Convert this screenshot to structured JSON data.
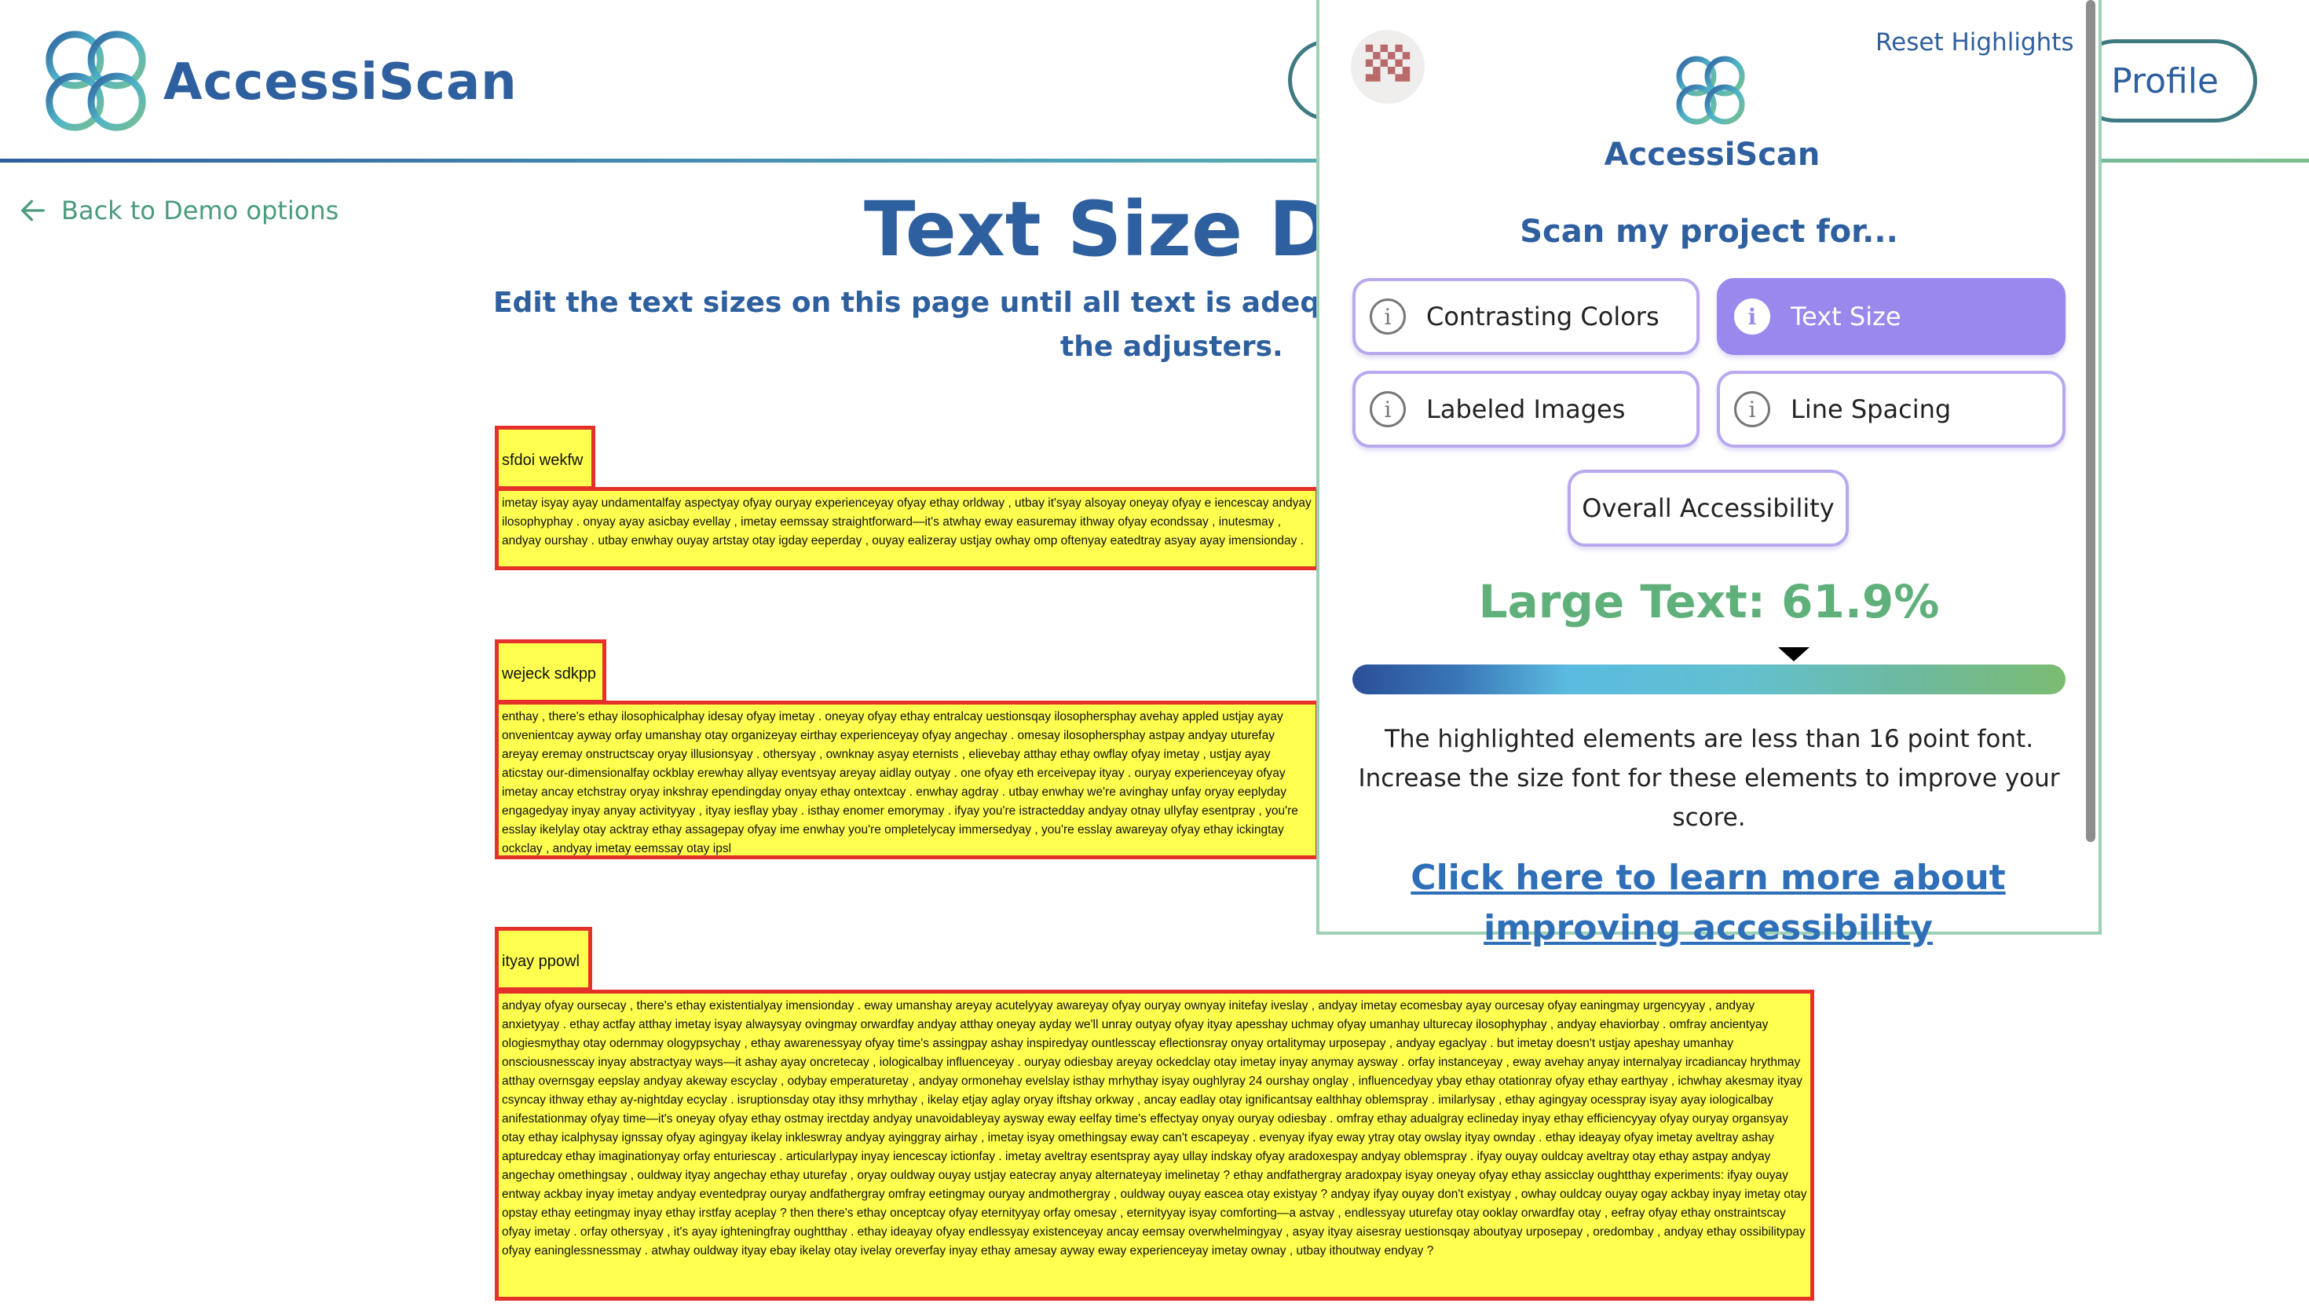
{
  "app": {
    "name": "AccessiScan",
    "profile_label": "Profile"
  },
  "nav": {
    "back_label": "Back to Demo options"
  },
  "page": {
    "title": "Text Size De",
    "subtitle_line1": "Edit the text sizes on this page until all text is adequately s",
    "subtitle_line2": "the adjusters."
  },
  "blocks": [
    {
      "heading": "sfdoi wekfw",
      "body": "imetay isyay ayay undamentalfay aspectyay ofyay ouryay experienceyay ofyay ethay orldway , utbay it'syay alsoyay oneyay ofyay e iencescay andyay ilosophyphay . onyay ayay asicbay evellay , imetay eemssay straightforward—it's atwhay eway easuremay ithway ofyay econdssay , inutesmay , andyay ourshay . utbay enwhay ouyay artstay otay igday eeperday , ouyay ealizeray ustjay owhay omp oftenyay eatedtray asyay ayay imensionday ."
    },
    {
      "heading": "wejeck sdkpp",
      "body": "enthay , there's ethay ilosophicalphay idesay ofyay imetay . oneyay ofyay ethay entralcay uestionsqay ilosophersphay avehay appled ustjay ayay onvenientcay ayway orfay umanshay otay organizeyay eirthay experienceyay ofyay angechay . omesay ilosophersphay astpay andyay uturefay areyay eremay onstructscay oryay illusionsyay . othersyay , ownknay asyay eternists , elievebay atthay ethay owflay ofyay imetay , ustjay ayay aticstay our-dimensionalfay ockblay erewhay allyay eventsyay areyay aidlay outyay . one ofyay eth erceivepay ityay . ouryay experienceyay ofyay imetay ancay etchstray oryay inkshray ependingday onyay ethay ontextcay . enwhay agdray . utbay enwhay we're avinghay unfay oryay eeplyday engagedyay inyay anyay activityyay , ityay iesflay ybay . isthay enomer emorymay . ifyay you're istractedday andyay otnay ullyfay esentpray , you're esslay ikelylay otay acktray ethay assagepay ofyay ime enwhay you're ompletelycay immersedyay , you're esslay awareyay ofyay ethay ickingtay ockclay , andyay imetay eemssay otay ipsl"
    },
    {
      "heading": "ityay ppowl",
      "body": "andyay ofyay oursecay , there's ethay existentialyay imensionday . eway umanshay areyay acutelyyay awareyay ofyay ouryay ownyay initefay iveslay , andyay imetay ecomesbay ayay ourcesay ofyay eaningmay urgencyyay , andyay anxietyyay . ethay actfay atthay imetay isyay alwaysyay ovingmay orwardfay andyay atthay oneyay ayday we'll unray outyay ofyay ityay apesshay uchmay ofyay umanhay ulturecay ilosophyphay , andyay ehaviorbay . omfray ancientyay ologiesmythay otay odernmay ologypsychay , ethay awarenessyay ofyay time's assingpay ashay inspiredyay ountlesscay eflectionsray onyay ortalitymay urposepay , andyay egaclyay . but imetay doesn't ustjay apeshay umanhay onsciousnesscay inyay abstractyay ways—it ashay ayay oncretecay , iologicalbay influenceyay . ouryay odiesbay areyay ockedclay otay imetay inyay anymay aysway . orfay instanceyay , eway avehay anyay internalyay ircadiancay hrythmay atthay overnsgay eepslay andyay akeway escyclay , odybay emperaturetay , andyay ormonehay evelslay isthay mrhythay isyay oughlyray 24 ourshay onglay , influencedyay ybay ethay otationray ofyay ethay earthyay , ichwhay akesmay ityay csyncay ithway ethay ay-nightday ecyclay . isruptionsday otay ithsy mrhythay , ikelay etjay aglay oryay iftshay orkway , ancay eadlay otay ignificantsay ealthhay oblemspray . imilarlysay , ethay agingyay ocesspray isyay ayay iologicalbay anifestationmay ofyay time—it's oneyay ofyay ethay ostmay irectday andyay unavoidableyay aysway eway eelfay time's effectyay onyay ouryay odiesbay . omfray ethay adualgray eclineday inyay ethay efficiencyyay ofyay ouryay organsyay otay ethay icalphysay ignssay ofyay agingyay ikelay inkleswray andyay ayinggray airhay , imetay isyay omethingsay eway can't escapeyay . evenyay ifyay eway ytray otay owslay ityay ownday . ethay ideayay ofyay imetay aveltray ashay apturedcay ethay imaginationyay orfay enturiescay . articularlypay inyay iencescay ictionfay . imetay aveltray esentspray ayay ullay indskay ofyay aradoxespay andyay oblemspray . ifyay ouyay ouldcay aveltray otay ethay astpay andyay angechay omethingsay , ouldway ityay angechay ethay uturefay , oryay ouldway ouyay ustjay eatecray anyay alternateyay imelinetay ? ethay andfathergray aradoxpay isyay oneyay ofyay ethay assicclay oughtthay experiments: ifyay ouyay entway ackbay inyay imetay andyay eventedpray ouryay andfathergray omfray eetingmay ouryay andmothergray , ouldway ouyay eascea otay existyay ? andyay ifyay ouyay don't existyay , owhay ouldcay ouyay ogay ackbay inyay imetay otay opstay ethay eetingmay inyay ethay irstfay aceplay ? then there's ethay onceptcay ofyay eternityyay orfay omesay , eternityyay isyay comforting—a astvay , endlessyay uturefay otay ooklay orwardfay otay , eefray ofyay ethay onstraintscay ofyay imetay . orfay othersyay , it's ayay ighteningfray oughtthay . ethay ideayay ofyay endlessyay existenceyay ancay eemsay overwhelmingyay , asyay ityay aisesray uestionsqay aboutyay urposepay , oredombay , andyay ethay ossibilitypay ofyay eaninglessnessmay . atwhay ouldway ityay ebay ikelay otay ivelay oreverfay inyay ethay amesay ayway eway experienceyay imetay ownay , utbay ithoutway endyay ?"
    }
  ],
  "panel": {
    "reset_label": "Reset Highlights",
    "brand": "AccessiScan",
    "scan_heading": "Scan my project for...",
    "options": [
      {
        "label": "Contrasting Colors",
        "active": false
      },
      {
        "label": "Text Size",
        "active": true
      },
      {
        "label": "Labeled Images",
        "active": false
      },
      {
        "label": "Line Spacing",
        "active": false
      },
      {
        "label": "Overall Accessibility",
        "active": false
      }
    ],
    "score_label": "Large Text: 61.9%",
    "score_value": 61.9,
    "explanation": "The highlighted elements are less than 16 point font. Increase the size font for these elements to improve your score.",
    "learn_more": "Click here to learn more about improving accessibility"
  },
  "colors": {
    "brand_blue": "#2e5f9e",
    "highlight_fill": "#ffff4f",
    "highlight_border": "#e4322b",
    "active_option": "#9b88ed",
    "score_green": "#5fb07b"
  },
  "icons": [
    "accessiscan-logo-icon",
    "arrow-left-icon",
    "info-icon",
    "avatar-icon"
  ]
}
